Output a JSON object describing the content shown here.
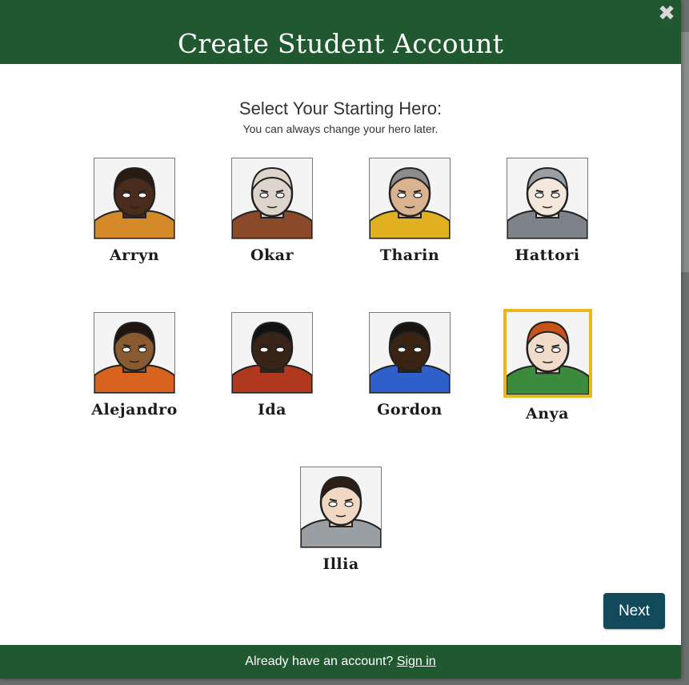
{
  "modal": {
    "title": "Create Student Account",
    "close_icon": "close-x-icon"
  },
  "prompt": {
    "heading": "Select Your Starting Hero:",
    "subheading": "You can always change your hero later."
  },
  "heroes": [
    {
      "name": "Arryn",
      "skin": "#4a2c1c",
      "hair": "#2a1a10",
      "armor": "#d58a2a",
      "selected": false
    },
    {
      "name": "Okar",
      "skin": "#ddd4cc",
      "hair": "#ddd4cc",
      "armor": "#8a4a2a",
      "selected": false
    },
    {
      "name": "Tharin",
      "skin": "#d9b38f",
      "hair": "#8c8c8c",
      "armor": "#e0b020",
      "selected": false
    },
    {
      "name": "Hattori",
      "skin": "#f3e6da",
      "hair": "#9a9fa3",
      "armor": "#7d8388",
      "selected": false
    },
    {
      "name": "Alejandro",
      "skin": "#8a5a30",
      "hair": "#1e1410",
      "armor": "#d8631f",
      "selected": false
    },
    {
      "name": "Ida",
      "skin": "#3a2418",
      "hair": "#121212",
      "armor": "#b0381f",
      "selected": false
    },
    {
      "name": "Gordon",
      "skin": "#3c2414",
      "hair": "#1a1410",
      "armor": "#2f5fc8",
      "selected": false
    },
    {
      "name": "Anya",
      "skin": "#f1dccb",
      "hair": "#c8521a",
      "armor": "#3c8a3c",
      "selected": true
    },
    {
      "name": "Illia",
      "skin": "#f0d8c2",
      "hair": "#2a1e16",
      "armor": "#9a9fa3",
      "selected": false
    }
  ],
  "actions": {
    "next_label": "Next"
  },
  "footer": {
    "text": "Already have an account?",
    "link": "Sign in"
  },
  "colors": {
    "header_green": "#20582f",
    "button_teal": "#124a5c",
    "selection_gold": "#e8b81c"
  }
}
